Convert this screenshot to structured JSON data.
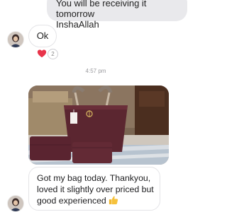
{
  "messages": {
    "top_outgoing": {
      "line1": "You will be receiving it tomorrow",
      "line2": "InshaAllah"
    },
    "ok_reply": {
      "text": "Ok",
      "reactions": {
        "heart": "heart-icon",
        "count": "2"
      }
    },
    "timestamp": "4:57 pm",
    "photo": {
      "subject": "bag-photo"
    },
    "review": {
      "line1": "Got my bag today. Thankyou,",
      "line2": "loved it slightly over priced but",
      "line3": "good experienced",
      "emoji": "thumbs-up-icon"
    }
  },
  "colors": {
    "outgoing_bubble": "#e9e9ec",
    "incoming_bubble_border": "#e4e4e7",
    "heart": "#e8344a",
    "timestamp": "#9b9b9f",
    "bag": "#5b2630"
  }
}
